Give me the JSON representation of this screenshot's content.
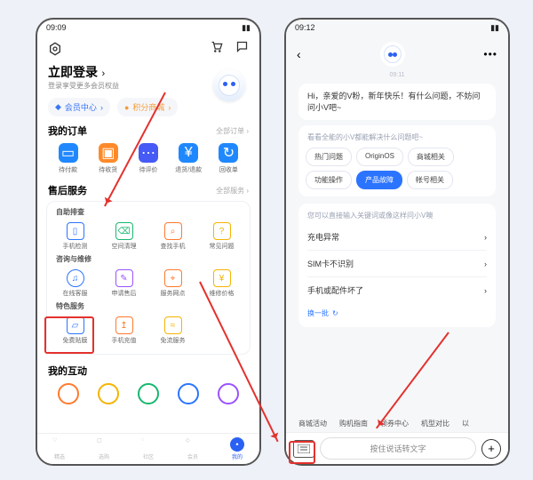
{
  "left": {
    "status_time": "09:09",
    "login_title": "立即登录",
    "login_sub": "登录享受更多会员权益",
    "chips": {
      "member": "会员中心",
      "points": "积分商城"
    },
    "orders": {
      "title": "我的订单",
      "more": "全部订单",
      "items": [
        "待付款",
        "待收货",
        "待评价",
        "退货/退款",
        "回收单"
      ]
    },
    "after": {
      "title": "售后服务",
      "more": "全部服务"
    },
    "self_check": {
      "title": "自助排查",
      "items": [
        "手机检测",
        "空间清理",
        "查找手机",
        "常见问题"
      ]
    },
    "consult": {
      "title": "咨询与维修",
      "items": [
        "在线客服",
        "申请售后",
        "服务网点",
        "维修价格"
      ]
    },
    "special": {
      "title": "特色服务",
      "items": [
        "免费贴膜",
        "手机充值",
        "免流服务"
      ]
    },
    "interact": {
      "title": "我的互动"
    },
    "tabs": [
      "精选",
      "选购",
      "社区",
      "会员",
      "我的"
    ]
  },
  "right": {
    "status_time": "09:12",
    "ts": "09:11",
    "greeting": "Hi，亲爱的V粉，新年快乐！有什么问题，不妨问问小V吧~",
    "adv_title": "看看全能的小V都能解决什么问题吧~",
    "chips_top": [
      "热门问题",
      "OriginOS",
      "商城相关"
    ],
    "chips_bot": [
      "功能操作",
      "产品故障",
      "帐号相关"
    ],
    "qa_title": "您可以直接输入关键词或像这样问小V噢",
    "qa_items": [
      "充电异常",
      "SIM卡不识别",
      "手机或配件坏了"
    ],
    "refresh": "换一批",
    "suggestions": [
      "商城活动",
      "购机指南",
      "领券中心",
      "机型对比",
      "以"
    ],
    "voice_placeholder": "按住说话转文字"
  }
}
